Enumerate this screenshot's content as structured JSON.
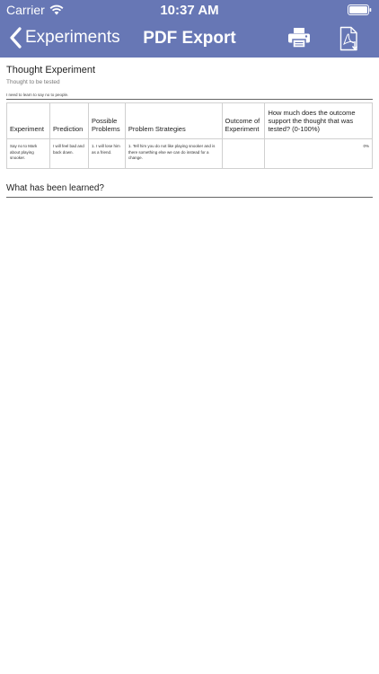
{
  "status_bar": {
    "carrier": "Carrier",
    "time": "10:37 AM"
  },
  "nav": {
    "back_label": "Experiments",
    "title": "PDF Export",
    "icons": [
      "chevron-left-icon",
      "printer-icon",
      "pdf-download-icon"
    ],
    "colors": {
      "bar": "#6777b5",
      "text": "#ffffff"
    }
  },
  "document": {
    "title": "Thought Experiment",
    "subtitle": "Thought to be tested",
    "note": "I need to learn to say no to people.",
    "table": {
      "headers": [
        "Experiment",
        "Prediction",
        "Possible Problems",
        "Problem Strategies",
        "Outcome of Experiment",
        "How much does the outcome support the thought that was tested? (0-100%)"
      ],
      "rows": [
        [
          "Say no to Mark about playing snooker.",
          "I will feel bad and back down.",
          "1. I will lose him as a friend.",
          "1. Tell him you do not like playing snooker and is there something else we can do instead for a change.",
          "",
          "0%"
        ]
      ]
    },
    "learned_heading": "What has been learned?"
  }
}
